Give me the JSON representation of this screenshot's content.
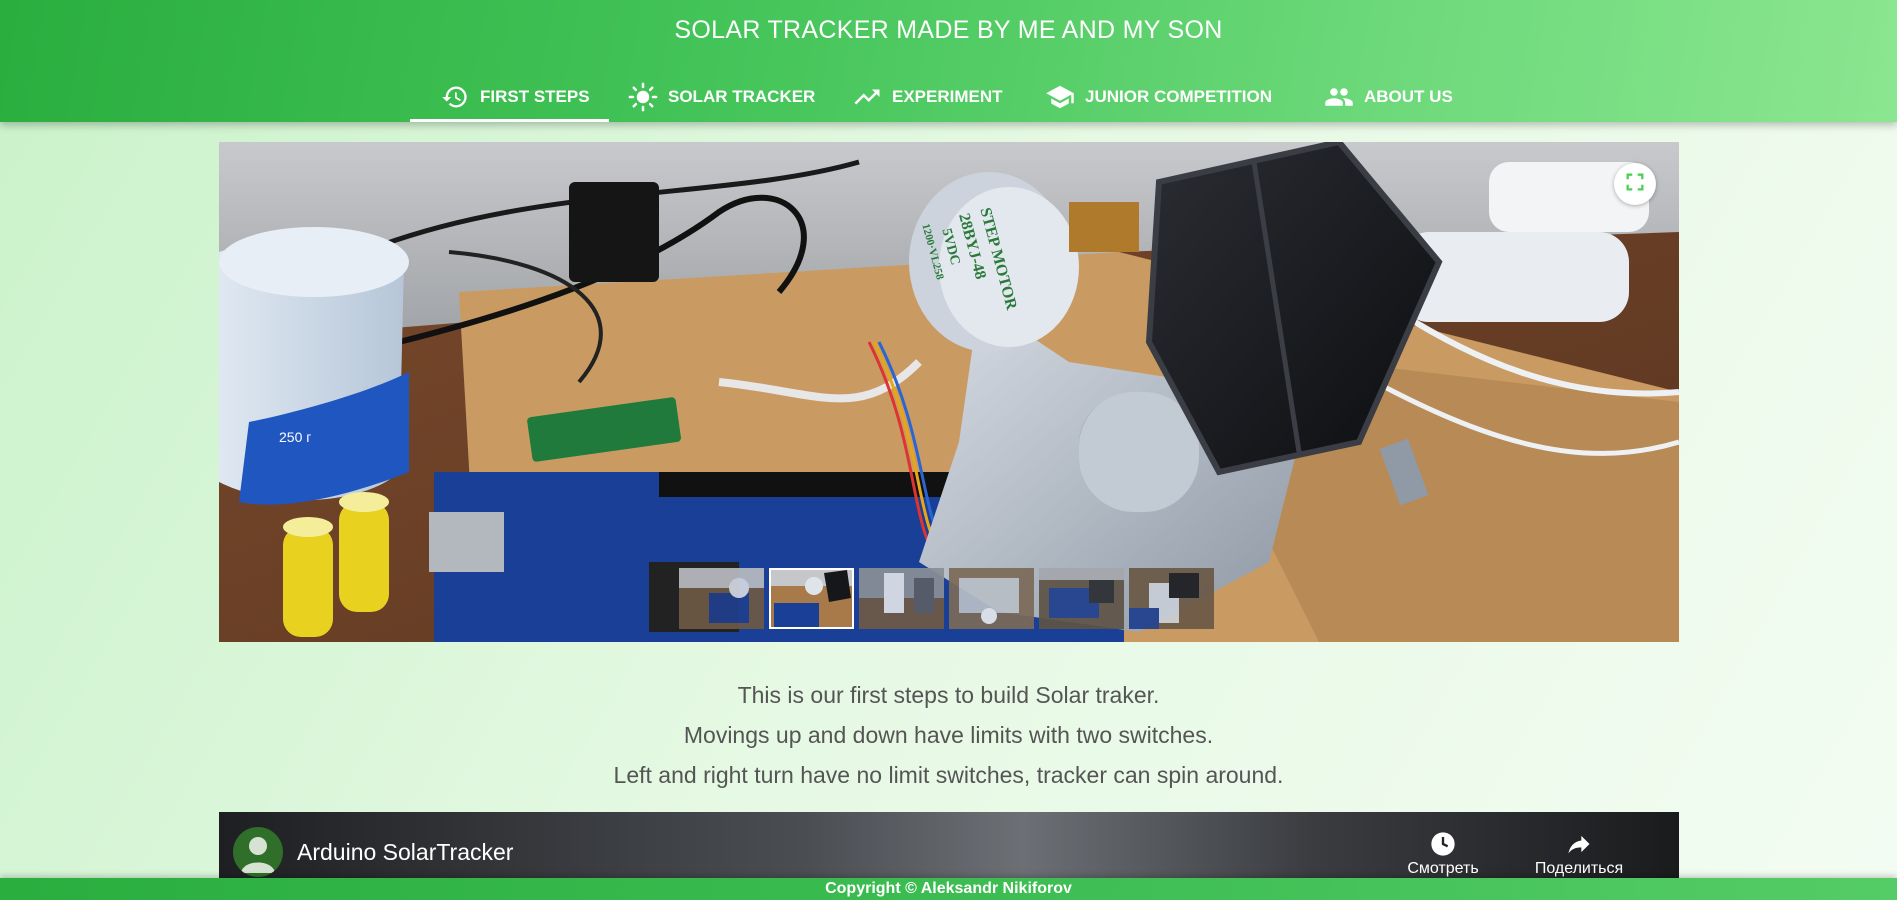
{
  "site": {
    "title": "SOLAR TRACKER MADE BY ME AND MY SON"
  },
  "nav": {
    "items": [
      {
        "label": "FIRST STEPS",
        "icon": "history-icon",
        "active": true
      },
      {
        "label": "SOLAR TRACKER",
        "icon": "sun-icon",
        "active": false
      },
      {
        "label": "EXPERIMENT",
        "icon": "trending-up-icon",
        "active": false
      },
      {
        "label": "JUNIOR COMPETITION",
        "icon": "school-icon",
        "active": false
      },
      {
        "label": "ABOUT US",
        "icon": "people-icon",
        "active": false
      }
    ]
  },
  "gallery": {
    "fullscreen_icon": "fullscreen-icon",
    "thumbnail_count": 6,
    "active_thumbnail": 2,
    "photo_text": {
      "motor_label": "STEP MOTOR",
      "motor_model": "28BYJ-48",
      "motor_voltage": "5VDC",
      "motor_code": "1200·VL258",
      "cup_label": "250 г"
    }
  },
  "description": {
    "lines": [
      "This is our first steps to build Solar traker.",
      "Movings up and down have limits with two switches.",
      "Left and right turn have no limit switches, tracker can spin around."
    ]
  },
  "video": {
    "title": "Arduino SolarTracker",
    "watch_later_label": "Смотреть позже",
    "share_label": "Поделиться"
  },
  "footer": {
    "copyright": "Copyright © Aleksandr Nikiforov"
  },
  "colors": {
    "header_start": "#2aae3e",
    "header_end": "#8be690",
    "page_bg": "#d8f5d6",
    "accent": "#4ccf5a"
  }
}
